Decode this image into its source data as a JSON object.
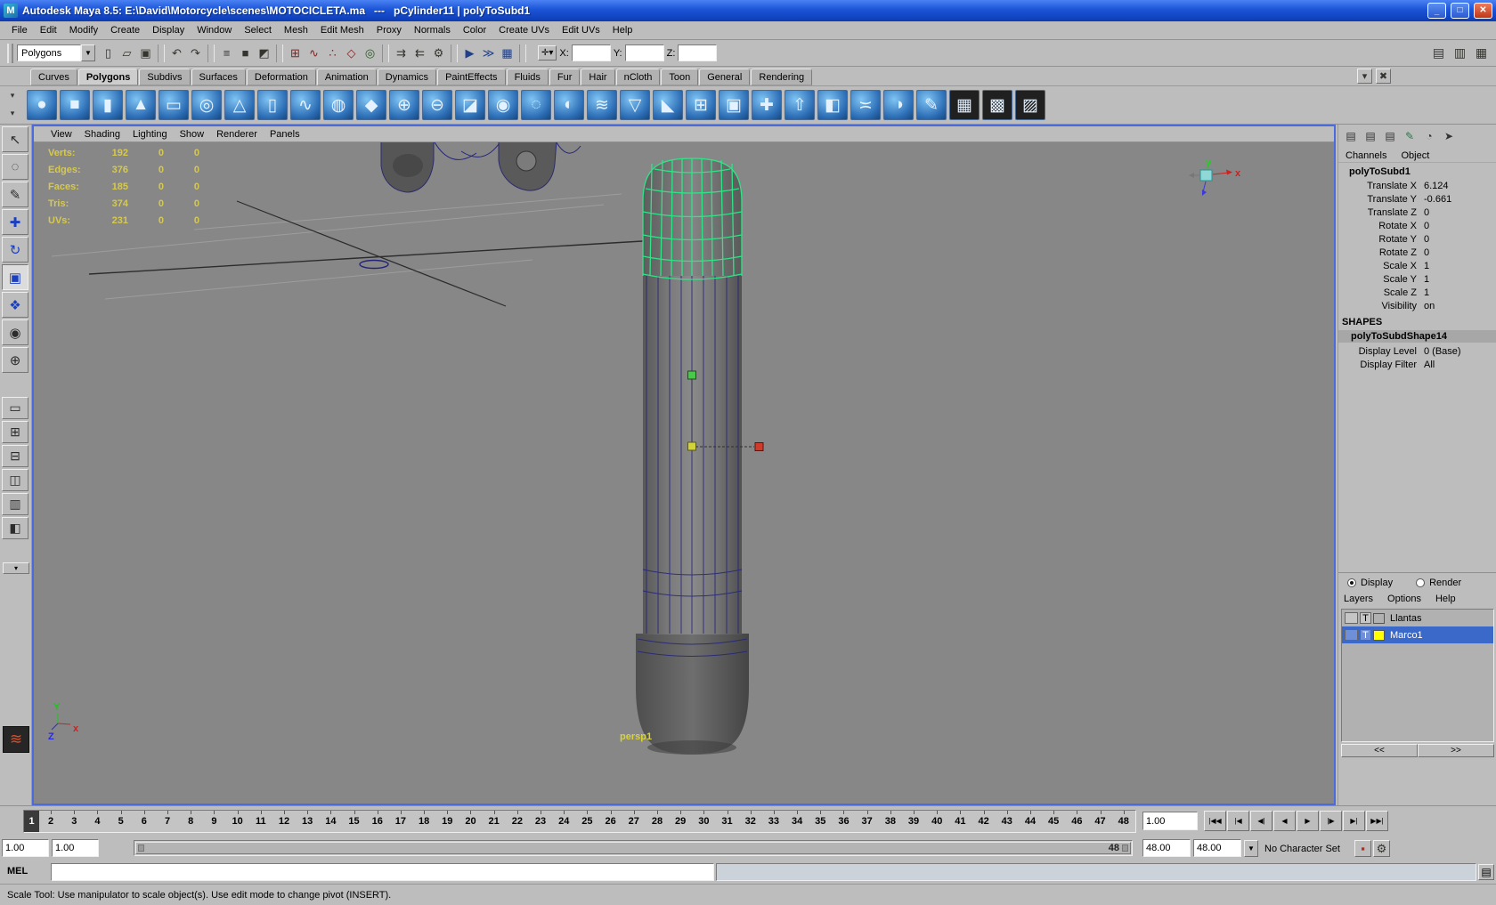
{
  "colors": {
    "titlebar_blue": "#1b54d6",
    "viewport_gray": "#878787",
    "selection_green": "#2fe487",
    "wireframe_navy": "#23237c",
    "manip_green": "#49c849",
    "manip_yellow": "#d2d23c",
    "manip_red": "#d03a2a",
    "layer_selection_blue": "#3b69c9",
    "layer_swatch_yellow": "#ffff00",
    "hud_yellow": "#d6c94f"
  },
  "window": {
    "icon_glyph": "M",
    "title": "Autodesk Maya 8.5: E:\\David\\Motorcycle\\scenes\\MOTOCICLETA.ma   ---   pCylinder11 | polyToSubd1",
    "minimize_glyph": "_",
    "maximize_glyph": "□",
    "close_glyph": "✕"
  },
  "menu_bar": [
    "File",
    "Edit",
    "Modify",
    "Create",
    "Display",
    "Window",
    "Select",
    "Mesh",
    "Edit Mesh",
    "Proxy",
    "Normals",
    "Color",
    "Create UVs",
    "Edit UVs",
    "Help"
  ],
  "status_line": {
    "selection_mask_label": "Polygons",
    "dropdown_glyph": "▼",
    "icons": [
      {
        "name": "new-scene-icon",
        "glyph": "▯"
      },
      {
        "name": "open-scene-icon",
        "glyph": "▱"
      },
      {
        "name": "save-scene-icon",
        "glyph": "▣"
      },
      {
        "name": "toolbar-separator",
        "sep": true
      },
      {
        "name": "undo-icon",
        "glyph": "↶"
      },
      {
        "name": "redo-icon",
        "glyph": "↷"
      },
      {
        "name": "toolbar-separator",
        "sep": true
      },
      {
        "name": "select-by-hierarchy-icon",
        "glyph": "≡"
      },
      {
        "name": "select-by-object-icon",
        "glyph": "■"
      },
      {
        "name": "select-by-component-icon",
        "glyph": "◩"
      },
      {
        "name": "toolbar-separator",
        "sep": true
      },
      {
        "name": "snap-to-grids-icon",
        "glyph": "⊞",
        "glyph_color": "#8a2020"
      },
      {
        "name": "snap-to-curves-icon",
        "glyph": "∿",
        "glyph_color": "#8a2020"
      },
      {
        "name": "snap-to-points-icon",
        "glyph": "∴",
        "glyph_color": "#8a2020"
      },
      {
        "name": "snap-to-view-planes-icon",
        "glyph": "◇",
        "glyph_color": "#8a2020"
      },
      {
        "name": "make-live-icon",
        "glyph": "◎",
        "glyph_color": "#206020"
      },
      {
        "name": "toolbar-separator",
        "sep": true
      },
      {
        "name": "input-connections-icon",
        "glyph": "⇉"
      },
      {
        "name": "output-connections-icon",
        "glyph": "⇇"
      },
      {
        "name": "construction-history-icon",
        "glyph": "⚙"
      },
      {
        "name": "toolbar-separator",
        "sep": true
      },
      {
        "name": "render-current-frame-icon",
        "glyph": "▶",
        "glyph_color": "#20408a"
      },
      {
        "name": "ipr-render-icon",
        "glyph": "≫",
        "glyph_color": "#20408a"
      },
      {
        "name": "render-settings-icon",
        "glyph": "▦",
        "glyph_color": "#20408a"
      },
      {
        "name": "toolbar-separator",
        "sep": true
      }
    ],
    "coord": {
      "mode_glyph": "✛▾",
      "x_label": "X:",
      "x_value": "",
      "y_label": "Y:",
      "y_value": "",
      "z_label": "Z:",
      "z_value": ""
    },
    "right_icons": [
      {
        "name": "show-attribute-editor-icon",
        "glyph": "▤"
      },
      {
        "name": "show-tool-settings-icon",
        "glyph": "▥"
      },
      {
        "name": "show-channel-box-icon",
        "glyph": "▦"
      }
    ]
  },
  "shelf": {
    "tabs": [
      {
        "name": "shelf-tab-curves",
        "label": "Curves"
      },
      {
        "name": "shelf-tab-polygons",
        "label": "Polygons",
        "active": true
      },
      {
        "name": "shelf-tab-subdivs",
        "label": "Subdivs"
      },
      {
        "name": "shelf-tab-surfaces",
        "label": "Surfaces"
      },
      {
        "name": "shelf-tab-deformation",
        "label": "Deformation"
      },
      {
        "name": "shelf-tab-animation",
        "label": "Animation"
      },
      {
        "name": "shelf-tab-dynamics",
        "label": "Dynamics"
      },
      {
        "name": "shelf-tab-painteffects",
        "label": "PaintEffects"
      },
      {
        "name": "shelf-tab-fluids",
        "label": "Fluids"
      },
      {
        "name": "shelf-tab-fur",
        "label": "Fur"
      },
      {
        "name": "shelf-tab-hair",
        "label": "Hair"
      },
      {
        "name": "shelf-tab-ncloth",
        "label": "nCloth"
      },
      {
        "name": "shelf-tab-toon",
        "label": "Toon"
      },
      {
        "name": "shelf-tab-general",
        "label": "General"
      },
      {
        "name": "shelf-tab-rendering",
        "label": "Rendering"
      }
    ],
    "tab_icons": [
      {
        "name": "shelf-tab-menu-icon",
        "glyph": "▾"
      },
      {
        "name": "delete-shelf-item-icon",
        "glyph": "✖"
      }
    ],
    "arrow_up_glyph": "▾",
    "arrow_down_glyph": "▾",
    "icons": [
      {
        "name": "poly-sphere-icon",
        "glyph": "●"
      },
      {
        "name": "poly-cube-icon",
        "glyph": "■"
      },
      {
        "name": "poly-cylinder-icon",
        "glyph": "▮"
      },
      {
        "name": "poly-cone-icon",
        "glyph": "▲"
      },
      {
        "name": "poly-plane-icon",
        "glyph": "▭"
      },
      {
        "name": "poly-torus-icon",
        "glyph": "◎"
      },
      {
        "name": "poly-pyramid-icon",
        "glyph": "△"
      },
      {
        "name": "poly-pipe-icon",
        "glyph": "▯"
      },
      {
        "name": "poly-helix-icon",
        "glyph": "∿"
      },
      {
        "name": "poly-soccer-ball-icon",
        "glyph": "◍"
      },
      {
        "name": "poly-platonic-solid-icon",
        "glyph": "◆"
      },
      {
        "name": "combine-icon",
        "glyph": "⊕"
      },
      {
        "name": "separate-icon",
        "glyph": "⊖"
      },
      {
        "name": "extract-icon",
        "glyph": "◪"
      },
      {
        "name": "boolean-union-icon",
        "glyph": "◉"
      },
      {
        "name": "boolean-difference-icon",
        "glyph": "◌"
      },
      {
        "name": "boolean-intersection-icon",
        "glyph": "◐"
      },
      {
        "name": "smooth-icon",
        "glyph": "≋"
      },
      {
        "name": "reduce-icon",
        "glyph": "▽"
      },
      {
        "name": "triangulate-icon",
        "glyph": "◣"
      },
      {
        "name": "quadrangulate-icon",
        "glyph": "⊞"
      },
      {
        "name": "fill-hole-icon",
        "glyph": "▣"
      },
      {
        "name": "append-polygon-icon",
        "glyph": "✚"
      },
      {
        "name": "extrude-icon",
        "glyph": "⇧"
      },
      {
        "name": "bevel-icon",
        "glyph": "◧"
      },
      {
        "name": "bridge-icon",
        "glyph": "≍"
      },
      {
        "name": "mirror-geometry-icon",
        "glyph": "◑"
      },
      {
        "name": "sculpt-geometry-icon",
        "glyph": "✎"
      },
      {
        "name": "uv-texture-editor-icon",
        "glyph": "▦",
        "bg": "#202020"
      },
      {
        "name": "checker-map-icon",
        "glyph": "▩",
        "bg": "#202020"
      },
      {
        "name": "uv-snapshot-icon",
        "glyph": "▨",
        "bg": "#202020"
      }
    ]
  },
  "toolbox": {
    "tools": [
      {
        "name": "select-tool-icon",
        "glyph": "↖"
      },
      {
        "name": "lasso-select-tool-icon",
        "glyph": "◌"
      },
      {
        "name": "paint-select-tool-icon",
        "glyph": "✎"
      },
      {
        "name": "move-tool-icon",
        "glyph": "✚",
        "glyph_color": "#1a3fbf"
      },
      {
        "name": "rotate-tool-icon",
        "glyph": "↻",
        "glyph_color": "#1a3fbf"
      },
      {
        "name": "scale-tool-icon",
        "glyph": "▣",
        "glyph_color": "#1a3fbf",
        "active": true
      },
      {
        "name": "universal-manipulator-icon",
        "glyph": "❖",
        "glyph_color": "#1a3fbf"
      },
      {
        "name": "soft-modification-icon",
        "glyph": "◉"
      },
      {
        "name": "show-manipulator-icon",
        "glyph": "⊕"
      }
    ],
    "layouts": [
      {
        "name": "single-pane-layout-icon",
        "glyph": "▭"
      },
      {
        "name": "four-pane-layout-icon",
        "glyph": "⊞"
      },
      {
        "name": "two-pane-stacked-layout-icon",
        "glyph": "⊟"
      },
      {
        "name": "two-pane-side-layout-icon",
        "glyph": "◫"
      },
      {
        "name": "three-pane-layout-icon",
        "glyph": "▥"
      },
      {
        "name": "outliner-persp-layout-icon",
        "glyph": "◧"
      }
    ],
    "dropdown_glyph": "▾",
    "current_tool_glyph": "≋"
  },
  "viewport": {
    "menus": [
      "View",
      "Shading",
      "Lighting",
      "Show",
      "Renderer",
      "Panels"
    ],
    "hud": [
      {
        "label": "Verts:",
        "v1": "192",
        "v2": "0",
        "v3": "0"
      },
      {
        "label": "Edges:",
        "v1": "376",
        "v2": "0",
        "v3": "0"
      },
      {
        "label": "Faces:",
        "v1": "185",
        "v2": "0",
        "v3": "0"
      },
      {
        "label": "Tris:",
        "v1": "374",
        "v2": "0",
        "v3": "0"
      },
      {
        "label": "UVs:",
        "v1": "231",
        "v2": "0",
        "v3": "0"
      }
    ],
    "camera_label": "persp1"
  },
  "channel_box": {
    "mini_icons": [
      {
        "name": "channel-layout-icon-1",
        "glyph": "▤"
      },
      {
        "name": "channel-layout-icon-2",
        "glyph": "▤"
      },
      {
        "name": "channel-layout-icon-3",
        "glyph": "▤"
      },
      {
        "name": "channel-manip-icon",
        "glyph": "✎",
        "glyph_color": "#2a7a4a"
      },
      {
        "name": "channel-speed-icon",
        "glyph": "◔"
      },
      {
        "name": "channel-pointer-icon",
        "glyph": "➤"
      }
    ],
    "tabs": [
      "Channels",
      "Object"
    ],
    "node_name": "polyToSubd1",
    "channels": [
      {
        "ch": "Translate X",
        "value": "6.124"
      },
      {
        "ch": "Translate Y",
        "value": "-0.661"
      },
      {
        "ch": "Translate Z",
        "value": "0"
      },
      {
        "ch": "Rotate X",
        "value": "0"
      },
      {
        "ch": "Rotate Y",
        "value": "0"
      },
      {
        "ch": "Rotate Z",
        "value": "0"
      },
      {
        "ch": "Scale X",
        "value": "1"
      },
      {
        "ch": "Scale Y",
        "value": "1"
      },
      {
        "ch": "Scale Z",
        "value": "1"
      },
      {
        "ch": "Visibility",
        "value": "on"
      }
    ],
    "shapes_header": "SHAPES",
    "shape_name": "polyToSubdShape14",
    "shape_channels": [
      {
        "ch": "Display Level",
        "value": "0 (Base)"
      },
      {
        "ch": "Display Filter",
        "value": "All"
      }
    ]
  },
  "layer_editor": {
    "radio_display": "Display",
    "radio_render": "Render",
    "menus": [
      "Layers",
      "Options",
      "Help"
    ],
    "layers": [
      {
        "name": "layer-row-llantas",
        "label": "Llantas",
        "t": "T"
      },
      {
        "name": "layer-row-marco1",
        "label": "Marco1",
        "t": "T",
        "selected": true,
        "swatch": "#ffff00"
      }
    ],
    "pager_left": "<<",
    "pager_right": ">>"
  },
  "time_slider": {
    "current_frame": "1",
    "frames": [
      "2",
      "3",
      "4",
      "5",
      "6",
      "7",
      "8",
      "9",
      "10",
      "11",
      "12",
      "13",
      "14",
      "15",
      "16",
      "17",
      "18",
      "19",
      "20",
      "21",
      "22",
      "23",
      "24",
      "25",
      "26",
      "27",
      "28",
      "29",
      "30",
      "31",
      "32",
      "33",
      "34",
      "35",
      "36",
      "37",
      "38",
      "39",
      "40",
      "41",
      "42",
      "43",
      "44",
      "45",
      "46",
      "47",
      "48"
    ],
    "time_field": "1.00",
    "playback": [
      {
        "name": "go-to-start-button",
        "glyph": "|◀◀"
      },
      {
        "name": "step-back-frame-button",
        "glyph": "|◀"
      },
      {
        "name": "step-back-key-button",
        "glyph": "◀|"
      },
      {
        "name": "play-backwards-button",
        "glyph": "◀"
      },
      {
        "name": "play-forwards-button",
        "glyph": "▶"
      },
      {
        "name": "step-forward-key-button",
        "glyph": "|▶"
      },
      {
        "name": "step-forward-frame-button",
        "glyph": "▶|"
      },
      {
        "name": "go-to-end-button",
        "glyph": "▶▶|"
      }
    ]
  },
  "range_slider": {
    "anim_start": "1.00",
    "play_start": "1.00",
    "range_end_label": "48",
    "play_end": "48.00",
    "anim_end": "48.00",
    "menu_glyph": "▼",
    "character_set": "No Character Set",
    "buttons": [
      {
        "name": "auto-keyframe-button",
        "glyph": "▪",
        "glyph_color": "#c02818"
      },
      {
        "name": "animation-preferences-button",
        "glyph": "⚙"
      }
    ]
  },
  "command_line": {
    "label": "MEL",
    "value": ""
  },
  "mel_icon_glyph": "▤",
  "help_line": {
    "text": "Scale Tool: Use manipulator to scale object(s). Use edit mode to change pivot (INSERT)."
  }
}
